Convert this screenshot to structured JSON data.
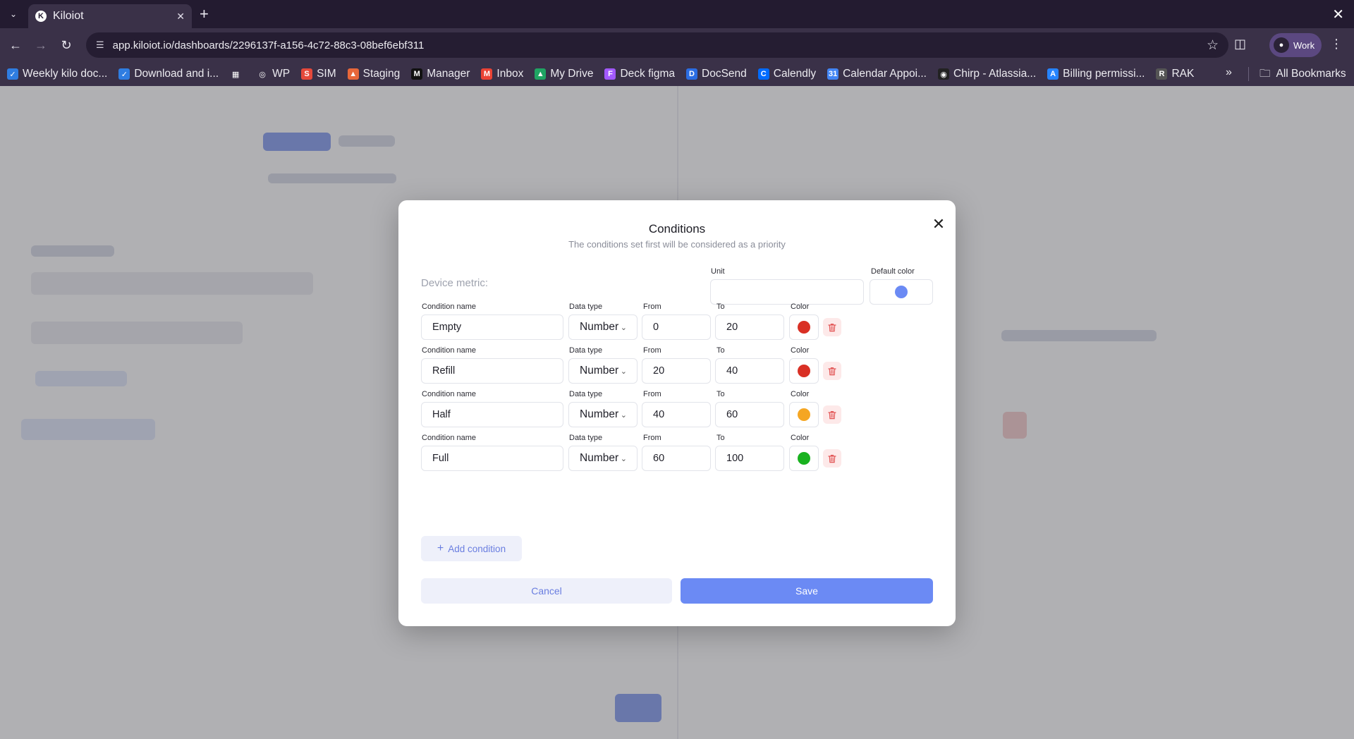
{
  "browser": {
    "tab_title": "Kiloiot",
    "url": "app.kiloiot.io/dashboards/2296137f-a156-4c72-88c3-08bef6ebf311",
    "profile_label": "Work",
    "bookmarks": [
      {
        "label": "Weekly kilo doc...",
        "icon": "checkbox-icon",
        "color": "#2f7de1"
      },
      {
        "label": "Download and i...",
        "icon": "checkbox-icon",
        "color": "#2f7de1"
      },
      {
        "label": "",
        "icon": "apps-grid-icon",
        "color": "#3a3148"
      },
      {
        "label": "WP",
        "icon": "globe-icon",
        "color": "#3a3148"
      },
      {
        "label": "SIM",
        "icon": "sim-icon",
        "color": "#e5493b"
      },
      {
        "label": "Staging",
        "icon": "staging-icon",
        "color": "#e8673a"
      },
      {
        "label": "Manager",
        "icon": "manager-icon",
        "color": "#111111"
      },
      {
        "label": "Inbox",
        "icon": "gmail-icon",
        "color": "#ea4335"
      },
      {
        "label": "My Drive",
        "icon": "drive-icon",
        "color": "#1fa463"
      },
      {
        "label": "Deck figma",
        "icon": "figma-icon",
        "color": "#a259ff"
      },
      {
        "label": "DocSend",
        "icon": "docsend-icon",
        "color": "#2b6de3"
      },
      {
        "label": "Calendly",
        "icon": "calendly-icon",
        "color": "#006bff"
      },
      {
        "label": "Calendar Appoi...",
        "icon": "calendar-icon",
        "color": "#4285f4"
      },
      {
        "label": "Chirp - Atlassia...",
        "icon": "chirp-icon",
        "color": "#222222"
      },
      {
        "label": "Billing permissi...",
        "icon": "atlassian-icon",
        "color": "#2684ff"
      },
      {
        "label": "RAK",
        "icon": "rak-icon",
        "color": "#555555"
      }
    ],
    "all_bookmarks_label": "All Bookmarks"
  },
  "modal": {
    "title": "Conditions",
    "subtitle": "The conditions set first will be considered as a priority",
    "device_metric_label": "Device metric:",
    "unit_label": "Unit",
    "unit_value": "",
    "default_color_label": "Default color",
    "default_color": "#6b8af4",
    "field_labels": {
      "condition_name": "Condition name",
      "data_type": "Data type",
      "from": "From",
      "to": "To",
      "color": "Color"
    },
    "conditions": [
      {
        "name": "Empty",
        "data_type": "Number",
        "from": "0",
        "to": "20",
        "color": "#d93025"
      },
      {
        "name": "Refill",
        "data_type": "Number",
        "from": "20",
        "to": "40",
        "color": "#d93025"
      },
      {
        "name": "Half",
        "data_type": "Number",
        "from": "40",
        "to": "60",
        "color": "#f5a623"
      },
      {
        "name": "Full",
        "data_type": "Number",
        "from": "60",
        "to": "100",
        "color": "#19b21f"
      }
    ],
    "add_condition_label": "Add condition",
    "cancel_label": "Cancel",
    "save_label": "Save"
  }
}
